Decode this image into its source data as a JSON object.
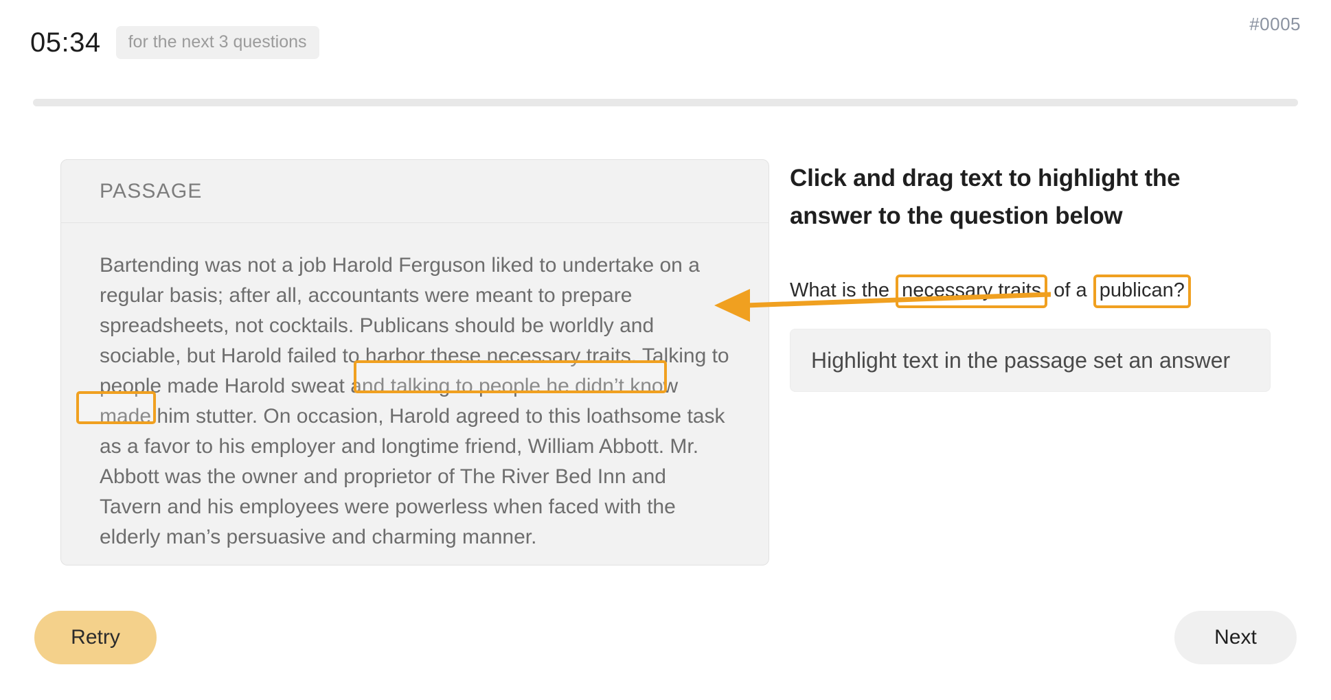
{
  "header": {
    "timer": "05:34",
    "timer_note": "for the next 3 questions",
    "question_number": "#0005",
    "progress_percent": 0
  },
  "passage_panel": {
    "label": "PASSAGE",
    "text": "Bartending was not a job Harold Ferguson liked to undertake on a regular basis; after all, accountants were meant to prepare spreadsheets, not cocktails. Publicans should be worldly and sociable, but Harold failed to harbor these necessary traits. Talking to people made Harold sweat and talking to people he didn’t know made him stutter. On occasion, Harold agreed to this loathsome task as a favor to his employer and longtime friend, William Abbott. Mr. Abbott was the owner and proprietor of The River Bed Inn and Tavern and his employees were powerless when faced with the elderly man’s persuasive and charming manner.",
    "selected_fragments": [
      "Publicans should be worldly and",
      "sociable,"
    ]
  },
  "right_panel": {
    "instruction": "Click and drag text to highlight the answer to the question below",
    "question_parts": {
      "lead": "What is the",
      "chip_one": "necessary traits",
      "middle": "of a",
      "chip_two": "publican?"
    },
    "answer_placeholder": "Highlight text in the passage set an answer"
  },
  "footer": {
    "retry_label": "Retry",
    "next_label": "Next"
  },
  "colors": {
    "accent_orange": "#f0a020",
    "retry_yellow": "#f4d18b",
    "panel_gray": "#f2f2f2",
    "muted_text": "#6d6d6d"
  }
}
